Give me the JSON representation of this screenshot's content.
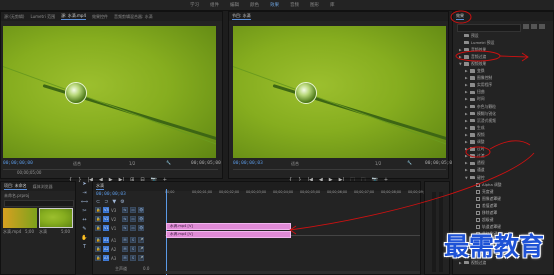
{
  "workspace": {
    "tabs": [
      "学习",
      "组件",
      "编辑",
      "颜色",
      "效果",
      "音频",
      "图形",
      "库"
    ],
    "active_index": 4
  },
  "source_monitor": {
    "tabs": [
      "源:(无剪辑)",
      "Lumetri 范围",
      "源: 水滴.mp4",
      "效果控件",
      "音频剪辑混合器: 水滴"
    ],
    "timecode_left": "00;00;00;00",
    "fit_label": "适合",
    "quality": "1/2",
    "timecode_right": "00;00;05;00",
    "ruler_label": "00;00;05;00"
  },
  "program_monitor": {
    "tab": "节目: 水滴",
    "timecode_left": "00;00;00;03",
    "fit_label": "适合",
    "quality": "1/2",
    "timecode_right": "00;00;05;00"
  },
  "controls": {
    "source": [
      "{",
      "}",
      "|◀",
      "◀",
      "▶",
      "▶|",
      "⊞",
      "⊟",
      "📷",
      "+"
    ],
    "program": [
      "{",
      "}",
      "|◀",
      "◀",
      "▶",
      "▶|",
      "⬚",
      "⬚",
      "📷",
      "+"
    ]
  },
  "effects_panel": {
    "title": "效果",
    "items": [
      {
        "indent": 0,
        "tri": "",
        "icon": "folder",
        "label": "预设"
      },
      {
        "indent": 0,
        "tri": "",
        "icon": "folder",
        "label": "Lumetri 预设"
      },
      {
        "indent": 0,
        "tri": "▶",
        "icon": "folder",
        "label": "音频效果"
      },
      {
        "indent": 0,
        "tri": "▶",
        "icon": "folder",
        "label": "音频过渡"
      },
      {
        "indent": 0,
        "tri": "▼",
        "icon": "folder",
        "label": "视频效果"
      },
      {
        "indent": 1,
        "tri": "▶",
        "icon": "folder",
        "label": "变换"
      },
      {
        "indent": 1,
        "tri": "▶",
        "icon": "folder",
        "label": "图像控制"
      },
      {
        "indent": 1,
        "tri": "▶",
        "icon": "folder",
        "label": "实用程序"
      },
      {
        "indent": 1,
        "tri": "▶",
        "icon": "folder",
        "label": "扭曲"
      },
      {
        "indent": 1,
        "tri": "▶",
        "icon": "folder",
        "label": "时间"
      },
      {
        "indent": 1,
        "tri": "▶",
        "icon": "folder",
        "label": "杂色与颗粒"
      },
      {
        "indent": 1,
        "tri": "▶",
        "icon": "folder",
        "label": "模糊与锐化"
      },
      {
        "indent": 1,
        "tri": "▶",
        "icon": "folder",
        "label": "沉浸式视频"
      },
      {
        "indent": 1,
        "tri": "▶",
        "icon": "folder",
        "label": "生成"
      },
      {
        "indent": 1,
        "tri": "▶",
        "icon": "folder",
        "label": "视频"
      },
      {
        "indent": 1,
        "tri": "▶",
        "icon": "folder",
        "label": "调整"
      },
      {
        "indent": 1,
        "tri": "▶",
        "icon": "folder",
        "label": "过时"
      },
      {
        "indent": 1,
        "tri": "▶",
        "icon": "folder",
        "label": "过渡"
      },
      {
        "indent": 1,
        "tri": "▶",
        "icon": "folder",
        "label": "透视"
      },
      {
        "indent": 1,
        "tri": "▶",
        "icon": "folder",
        "label": "通道"
      },
      {
        "indent": 1,
        "tri": "▼",
        "icon": "folder",
        "label": "键控"
      },
      {
        "indent": 2,
        "tri": "",
        "icon": "fx",
        "label": "Alpha 调整"
      },
      {
        "indent": 2,
        "tri": "",
        "icon": "fx",
        "label": "亮度键"
      },
      {
        "indent": 2,
        "tri": "",
        "icon": "fx",
        "label": "图像遮罩键"
      },
      {
        "indent": 2,
        "tri": "",
        "icon": "fx",
        "label": "差值遮罩"
      },
      {
        "indent": 2,
        "tri": "",
        "icon": "fx",
        "label": "移除遮罩"
      },
      {
        "indent": 2,
        "tri": "",
        "icon": "fx",
        "label": "超级键"
      },
      {
        "indent": 2,
        "tri": "",
        "icon": "fx",
        "label": "轨道遮罩键"
      },
      {
        "indent": 2,
        "tri": "",
        "icon": "fx",
        "label": "非红色键"
      },
      {
        "indent": 2,
        "tri": "",
        "icon": "fx",
        "label": "颜色键"
      },
      {
        "indent": 1,
        "tri": "▶",
        "icon": "folder",
        "label": "颜色校正"
      },
      {
        "indent": 1,
        "tri": "▶",
        "icon": "folder",
        "label": "风格化"
      },
      {
        "indent": 0,
        "tri": "▶",
        "icon": "folder",
        "label": "视频过渡"
      }
    ]
  },
  "project_panel": {
    "tabs": [
      "项目: 未命名",
      "媒体浏览器"
    ],
    "path": "未命名.prproj",
    "items": [
      {
        "name": "水滴.mp4",
        "duration": "5;00"
      },
      {
        "name": "水滴",
        "duration": "5;00"
      }
    ]
  },
  "timeline": {
    "tab": "水滴",
    "timecode": "00;00;00;03",
    "ruler": [
      "00;00",
      "00;00;01;00",
      "00;00;02;00",
      "00;00;03;00",
      "00;00;04;00",
      "00;00;05;00",
      "00;00;06;00",
      "00;00;07;00",
      "00;00;08;00",
      "00;00;09;00"
    ],
    "tracks": [
      {
        "id": "V3",
        "kind": "v"
      },
      {
        "id": "V2",
        "kind": "v"
      },
      {
        "id": "V1",
        "kind": "v"
      },
      {
        "id": "A1",
        "kind": "a"
      },
      {
        "id": "A2",
        "kind": "a"
      },
      {
        "id": "A3",
        "kind": "a"
      }
    ],
    "clips": [
      {
        "label": "水滴.mp4 [V]",
        "track": "V2"
      },
      {
        "label": "水滴.mp4 [V]",
        "track": "V1"
      }
    ],
    "master_label": "主声道",
    "master_value": "0.0"
  },
  "watermark": "最需教育",
  "colors": {
    "accent_blue": "#2e6ac9",
    "clip_pink": "#e08ad6",
    "annotation_red": "#cc1111",
    "watermark_blue": "#1e52d6"
  }
}
